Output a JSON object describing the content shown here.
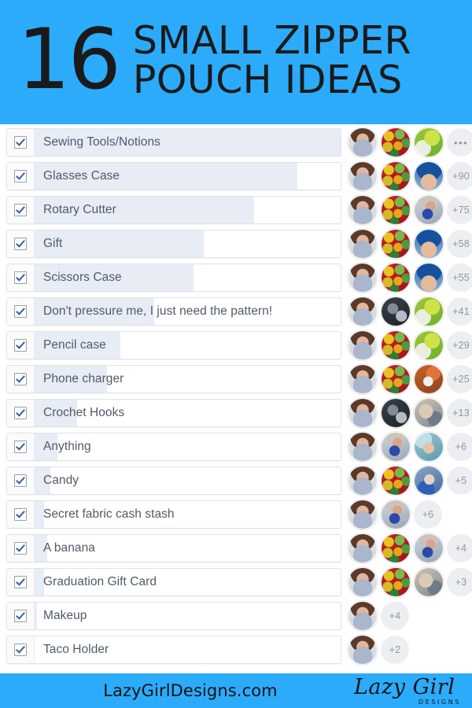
{
  "header": {
    "number": "16",
    "line1": "SMALL ZIPPER",
    "line2": "POUCH IDEAS",
    "background_color": "#2cabfb",
    "text_color": "#1a1a1a"
  },
  "poll": {
    "track_color": "#ffffff",
    "fill_color": "#e7ecf5",
    "label_color": "#515b68",
    "badge_color": "#eceef1",
    "checkbox_checked": true,
    "rows": [
      {
        "label": "Sewing Tools/Notions",
        "checked": true,
        "fill_percent": 100,
        "badge": "•••",
        "badge_is_dots": true,
        "avatars": [
          "woman",
          "candy",
          "green"
        ]
      },
      {
        "label": "Glasses Case",
        "checked": true,
        "fill_percent": 87,
        "badge": "+90",
        "badge_is_dots": false,
        "avatars": [
          "woman",
          "candy",
          "bluehat"
        ]
      },
      {
        "label": "Rotary Cutter",
        "checked": true,
        "fill_percent": 74,
        "badge": "+75",
        "badge_is_dots": false,
        "avatars": [
          "woman",
          "candy",
          "kid"
        ]
      },
      {
        "label": "Gift",
        "checked": true,
        "fill_percent": 59,
        "badge": "+58",
        "badge_is_dots": false,
        "avatars": [
          "woman",
          "candy",
          "bluehat"
        ]
      },
      {
        "label": "Scissors Case",
        "checked": true,
        "fill_percent": 56,
        "badge": "+55",
        "badge_is_dots": false,
        "avatars": [
          "woman",
          "candy",
          "bluehat"
        ]
      },
      {
        "label": "Don't pressure me, I just need the pattern!",
        "checked": true,
        "fill_percent": 44,
        "badge": "+41",
        "badge_is_dots": false,
        "avatars": [
          "woman",
          "dark",
          "green"
        ]
      },
      {
        "label": "Pencil case",
        "checked": true,
        "fill_percent": 34,
        "badge": "+29",
        "badge_is_dots": false,
        "avatars": [
          "woman",
          "candy",
          "green"
        ]
      },
      {
        "label": "Phone charger",
        "checked": true,
        "fill_percent": 30,
        "badge": "+25",
        "badge_is_dots": false,
        "avatars": [
          "woman",
          "candy",
          "orange"
        ]
      },
      {
        "label": "Crochet Hooks",
        "checked": true,
        "fill_percent": 21,
        "badge": "+13",
        "badge_is_dots": false,
        "avatars": [
          "woman",
          "dark",
          "tan"
        ]
      },
      {
        "label": "Anything",
        "checked": true,
        "fill_percent": 15,
        "badge": "+6",
        "badge_is_dots": false,
        "avatars": [
          "woman",
          "kid",
          "teal"
        ]
      },
      {
        "label": "Candy",
        "checked": true,
        "fill_percent": 13,
        "badge": "+5",
        "badge_is_dots": false,
        "avatars": [
          "woman",
          "candy",
          "blueperson"
        ]
      },
      {
        "label": "Secret fabric cash stash",
        "checked": true,
        "fill_percent": 11,
        "badge": "+6",
        "badge_is_dots": false,
        "avatars": [
          "woman",
          "kid"
        ]
      },
      {
        "label": "A banana",
        "checked": true,
        "fill_percent": 12,
        "badge": "+4",
        "badge_is_dots": false,
        "avatars": [
          "woman",
          "candy",
          "kid"
        ]
      },
      {
        "label": "Graduation Gift Card",
        "checked": true,
        "fill_percent": 11,
        "badge": "+3",
        "badge_is_dots": false,
        "avatars": [
          "woman",
          "candy",
          "tan"
        ]
      },
      {
        "label": "Makeup",
        "checked": true,
        "fill_percent": 9,
        "badge": "+4",
        "badge_is_dots": false,
        "avatars": [
          "woman"
        ]
      },
      {
        "label": "Taco Holder",
        "checked": true,
        "fill_percent": 8,
        "badge": "+2",
        "badge_is_dots": false,
        "avatars": [
          "woman"
        ]
      }
    ]
  },
  "footer": {
    "url": "LazyGirlDesigns.com",
    "logo_script": "Lazy Girl",
    "logo_sub": "DESIGNS",
    "background_color": "#2cabfb"
  }
}
